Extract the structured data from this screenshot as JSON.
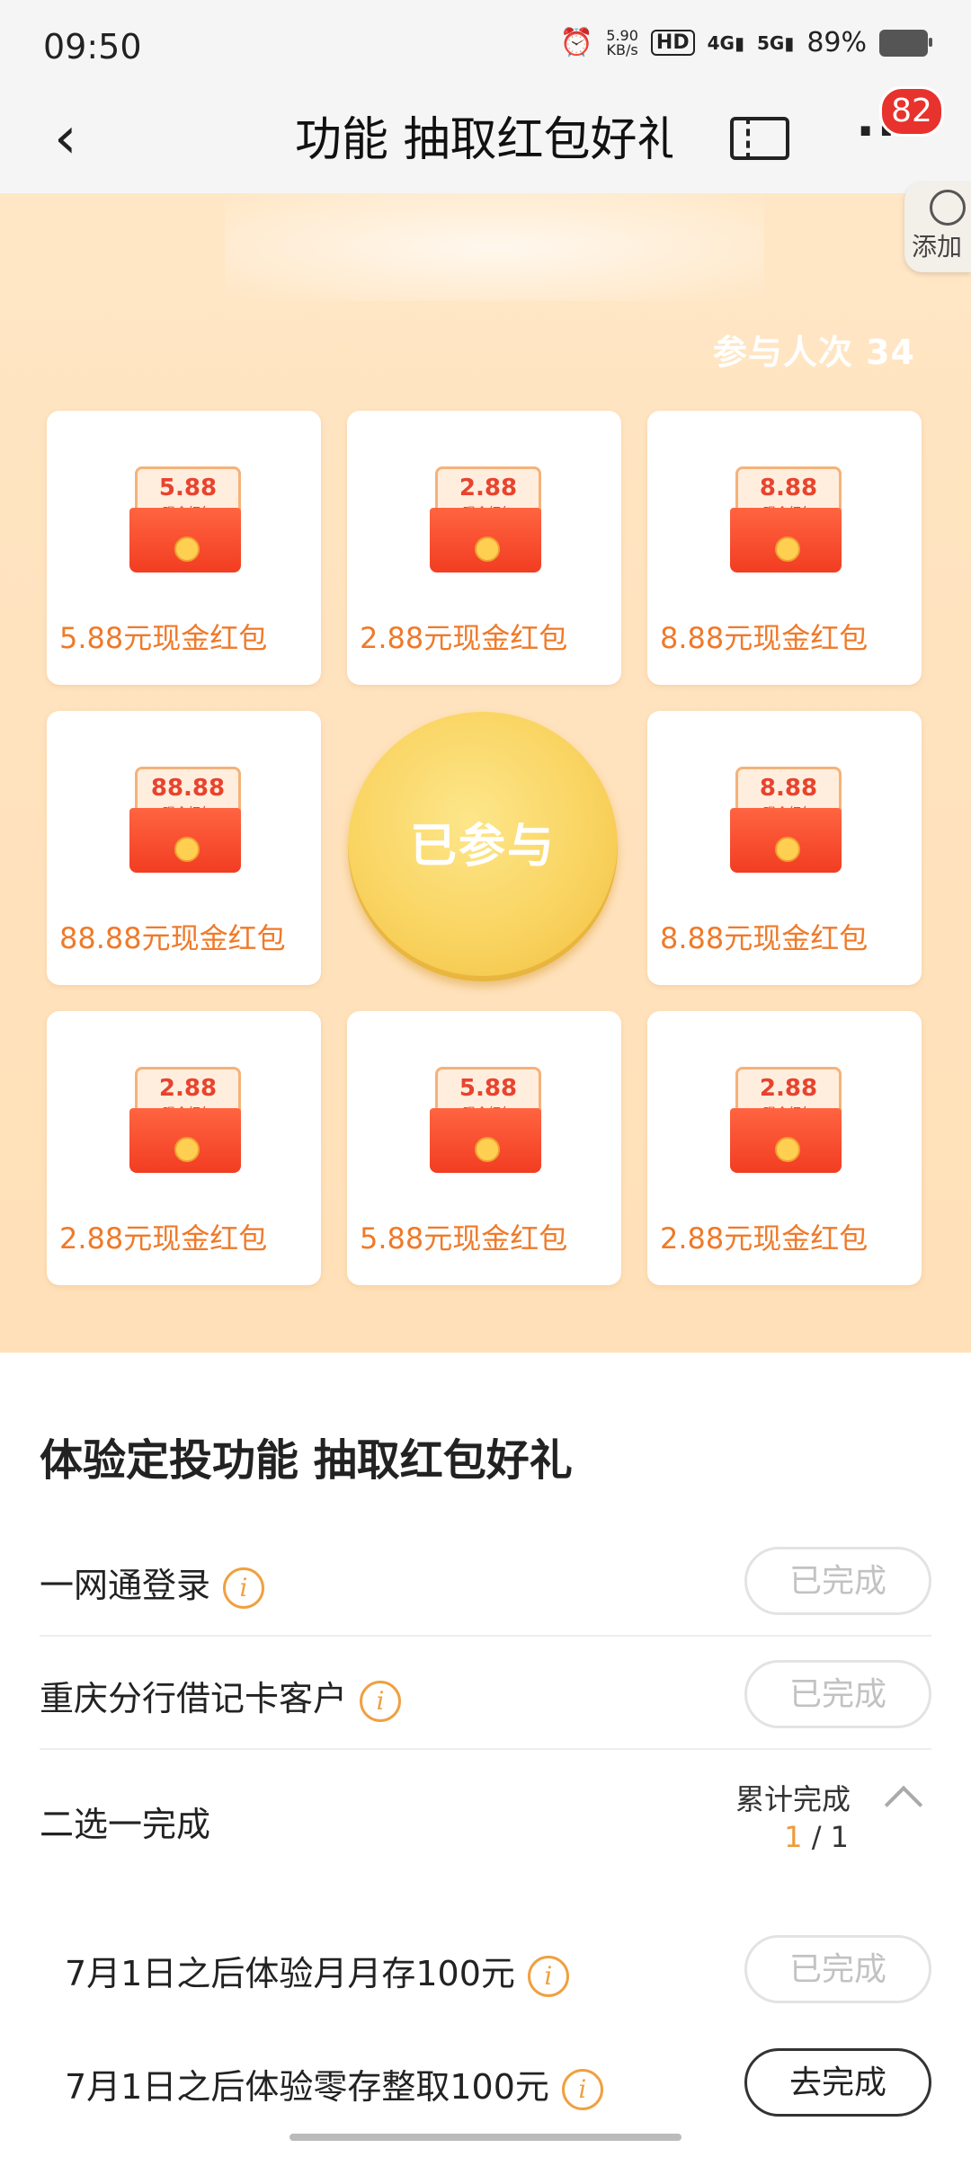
{
  "status_bar": {
    "time": "09:50",
    "net_speed_value": "5.90",
    "net_speed_unit": "KB/s",
    "hd": "HD",
    "sig1": "4G",
    "sig2": "5G",
    "battery": "89%"
  },
  "nav": {
    "title": "功能 抽取红包好礼",
    "badge_count": "82"
  },
  "hero": {
    "add_label": "添加",
    "participants": "参与人次 34",
    "center_button": "已参与",
    "prizes": [
      {
        "amount": "5.88",
        "sub": "现金红包",
        "label": "5.88元现金红包"
      },
      {
        "amount": "2.88",
        "sub": "现金红包",
        "label": "2.88元现金红包"
      },
      {
        "amount": "8.88",
        "sub": "现金红包",
        "label": "8.88元现金红包"
      },
      {
        "amount": "88.88",
        "sub": "现金红包",
        "label": "88.88元现金红包"
      },
      {
        "amount": "8.88",
        "sub": "现金红包",
        "label": "8.88元现金红包"
      },
      {
        "amount": "2.88",
        "sub": "现金红包",
        "label": "2.88元现金红包"
      },
      {
        "amount": "5.88",
        "sub": "现金红包",
        "label": "5.88元现金红包"
      },
      {
        "amount": "2.88",
        "sub": "现金红包",
        "label": "2.88元现金红包"
      }
    ]
  },
  "tasks": {
    "title": "体验定投功能 抽取红包好礼",
    "items": [
      {
        "label": "一网通登录",
        "button": "已完成"
      },
      {
        "label": "重庆分行借记卡客户",
        "button": "已完成"
      }
    ],
    "group": {
      "label": "二选一完成",
      "progress_label": "累计完成",
      "progress_current": "1",
      "progress_total": "/ 1",
      "subitems": [
        {
          "label": "7月1日之后体验月月存100元",
          "button": "已完成"
        },
        {
          "label": "7月1日之后体验零存整取100元",
          "button": "去完成"
        }
      ]
    }
  },
  "colors": {
    "accent_orange": "#ef7a2a",
    "badge_red": "#e8322d",
    "hero_bg": "#ffe4c1"
  }
}
